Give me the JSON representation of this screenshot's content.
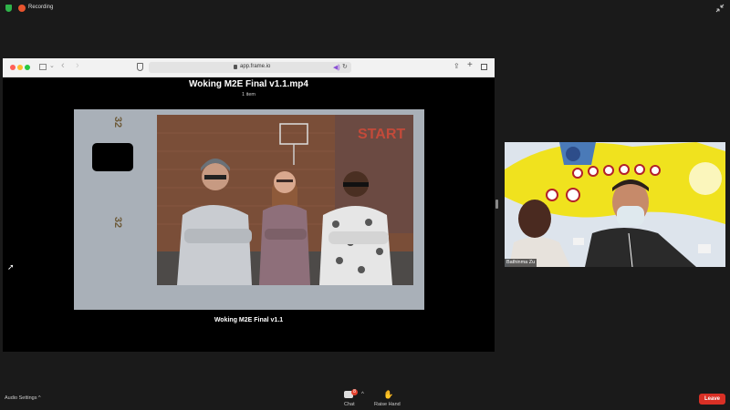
{
  "top_bar": {
    "recording_label": "Recording"
  },
  "browser": {
    "url": "app.frame.io",
    "file_title": "Woking M2E Final v1.1.mp4",
    "item_count": "1 item",
    "film_numbers": [
      "32",
      "32"
    ],
    "caption": "Woking M2E Final v1.1"
  },
  "participant": {
    "name": "Bathinma Zu"
  },
  "toolbar": {
    "audio_settings": "Audio Settings",
    "chat_label": "Chat",
    "chat_badge": "8",
    "raise_hand_label": "Raise Hand",
    "leave_label": "Leave"
  },
  "colors": {
    "leave": "#d93025",
    "recording": "#e8542e",
    "shield": "#2fb34a"
  }
}
